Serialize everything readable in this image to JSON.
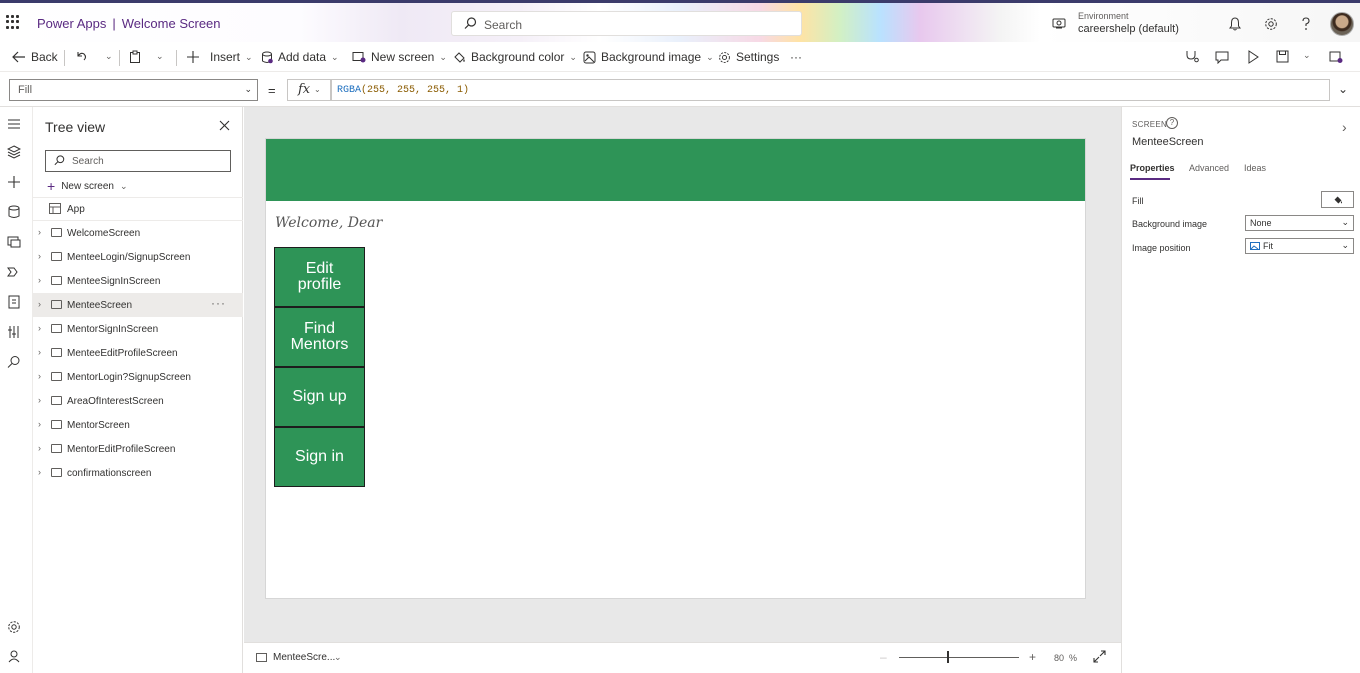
{
  "header": {
    "app_name": "Power Apps",
    "separator": "|",
    "screen_title": "Welcome Screen",
    "search_placeholder": "Search",
    "environment_label": "Environment",
    "environment_value": "careershelp (default)"
  },
  "commands": {
    "back": "Back",
    "insert": "Insert",
    "add_data": "Add data",
    "new_screen": "New screen",
    "background_color": "Background color",
    "background_image": "Background image",
    "settings": "Settings",
    "more": "···"
  },
  "formula_bar": {
    "property": "Fill",
    "equals": "=",
    "fx": "fx",
    "formula_fn": "RGBA",
    "formula_args": "(255, 255, 255, 1)"
  },
  "tree": {
    "title": "Tree view",
    "search_placeholder": "Search",
    "new_screen": "New screen",
    "app_item": "App",
    "more": "···",
    "screens": [
      "WelcomeScreen",
      "MenteeLogin/SignupScreen",
      "MenteeSignInScreen",
      "MenteeScreen",
      "MentorSignInScreen",
      "MenteeEditProfileScreen",
      "MentorLogin?SignupScreen",
      "AreaOfInterestScreen",
      "MentorScreen",
      "MentorEditProfileScreen",
      "confirmationscreen"
    ],
    "selected_index": 3
  },
  "canvas": {
    "welcome_text": "Welcome, Dear",
    "buttons": [
      "Edit profile",
      "Find Mentors",
      "Sign up",
      "Sign in"
    ],
    "colors": {
      "header": "#2e9457",
      "button": "#2e9457"
    }
  },
  "status": {
    "screen_name": "MenteeScre...",
    "zoom_value": "80",
    "zoom_unit": "%",
    "zoom_percent": 80
  },
  "properties": {
    "type": "SCREEN",
    "screen_name": "MenteeScreen",
    "tabs": [
      "Properties",
      "Advanced",
      "Ideas"
    ],
    "fill_label": "Fill",
    "background_image_label": "Background image",
    "background_image_value": "None",
    "image_position_label": "Image position",
    "image_position_value": "Fit"
  },
  "icons": [
    "waffle-icon",
    "search-icon",
    "environment-icon",
    "bell-icon",
    "gear-icon",
    "help-icon",
    "back-arrow-icon",
    "undo-icon",
    "paste-icon",
    "plus-icon",
    "database-icon",
    "screen-icon",
    "paint-icon",
    "image-icon",
    "stethoscope-icon",
    "comment-icon",
    "play-icon",
    "save-icon",
    "publish-icon",
    "close-icon",
    "chevron-right-icon",
    "expand-icon"
  ],
  "accent": "#5a2a82"
}
